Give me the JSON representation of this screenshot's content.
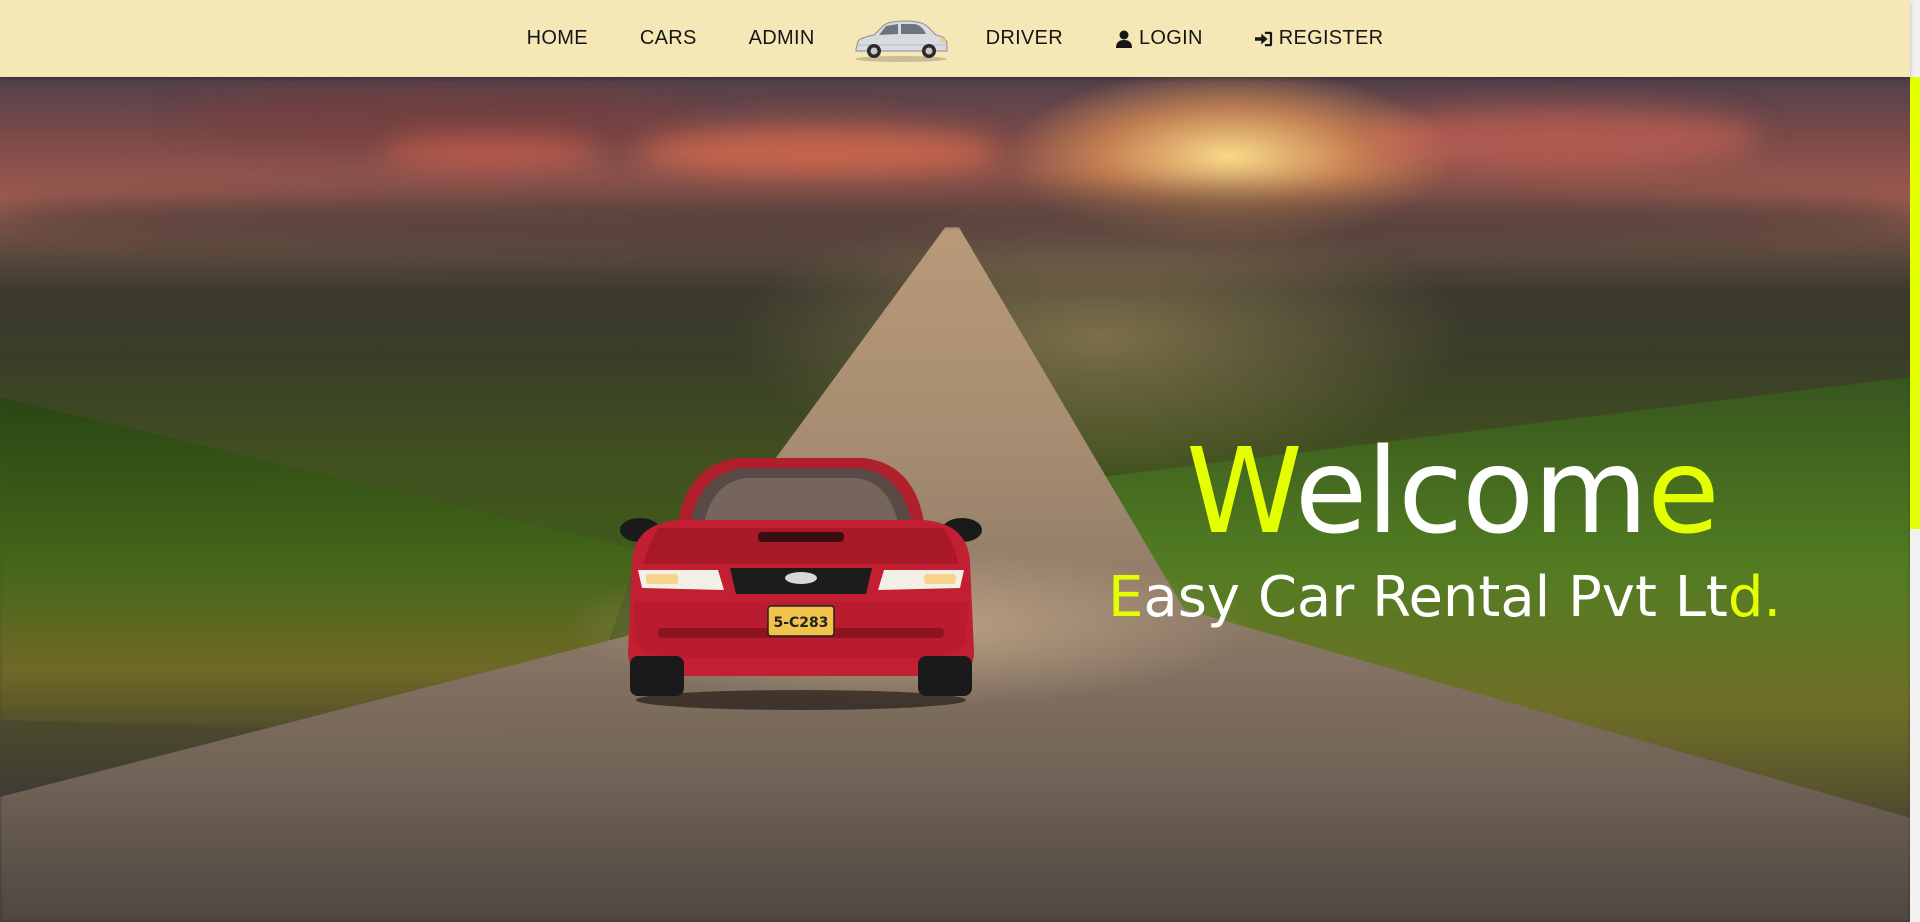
{
  "navbar": {
    "items": {
      "home": "HOME",
      "cars": "CARS",
      "admin": "ADMIN",
      "driver": "DRIVER",
      "login": "LOGIN",
      "register": "REGISTER"
    },
    "icons": {
      "logo": "car-logo-icon",
      "login": "user-icon",
      "register": "sign-in-icon"
    },
    "background": "#f6e7b7"
  },
  "hero": {
    "welcome": {
      "first": "W",
      "middle": "elcom",
      "last": "e"
    },
    "company": {
      "first": "E",
      "middle": "asy Car Rental Pvt Lt",
      "last": "d."
    },
    "accent_color": "#e3ff00",
    "background_image": "red-car-on-country-road"
  },
  "scrollbar": {
    "thumb_color": "#e3ff00"
  }
}
